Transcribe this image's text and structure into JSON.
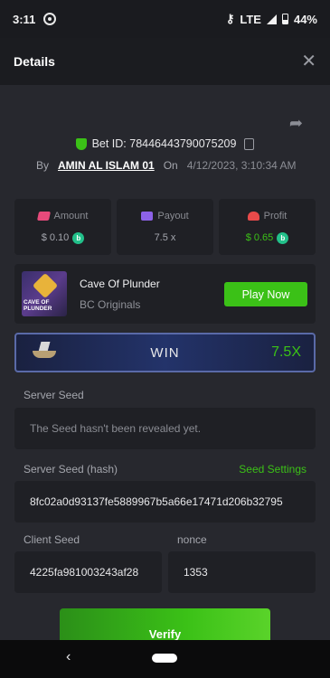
{
  "status_bar": {
    "time": "3:11",
    "network": "LTE",
    "battery": "44%"
  },
  "header": {
    "title": "Details",
    "close_symbol": "✕"
  },
  "bet": {
    "bet_id_text": "Bet ID: 78446443790075209",
    "by_label": "By",
    "user": "AMIN AL ISLAM 01",
    "on_label": "On",
    "date": "4/12/2023, 3:10:34 AM"
  },
  "stats": [
    {
      "label": "Amount",
      "value": "$ 0.10",
      "icon": "amount-icon"
    },
    {
      "label": "Payout",
      "value": "7.5 x",
      "icon": "payout-icon"
    },
    {
      "label": "Profit",
      "value": "$ 0.65",
      "icon": "profit-icon"
    }
  ],
  "game": {
    "thumb_text": "CAVE OF PLUNDER",
    "name": "Cave Of Plunder",
    "provider": "BC Originals",
    "play_label": "Play Now"
  },
  "result": {
    "label": "WIN",
    "multiplier": "7.5X"
  },
  "server_seed": {
    "label": "Server Seed",
    "value": "The Seed hasn't been revealed yet."
  },
  "server_seed_hash": {
    "label": "Server Seed (hash)",
    "settings_link": "Seed Settings",
    "value": "8fc02a0d93137fe5889967b5a66e17471d206b32795"
  },
  "client_seed": {
    "label": "Client Seed",
    "value": "4225fa981003243af28"
  },
  "nonce": {
    "label": "nonce",
    "value": "1353"
  },
  "verify_label": "Verify",
  "nav": {
    "back_symbol": "‹"
  },
  "colors": {
    "accent_green": "#3bc117",
    "background": "#27282e",
    "panel": "#1f2025"
  }
}
